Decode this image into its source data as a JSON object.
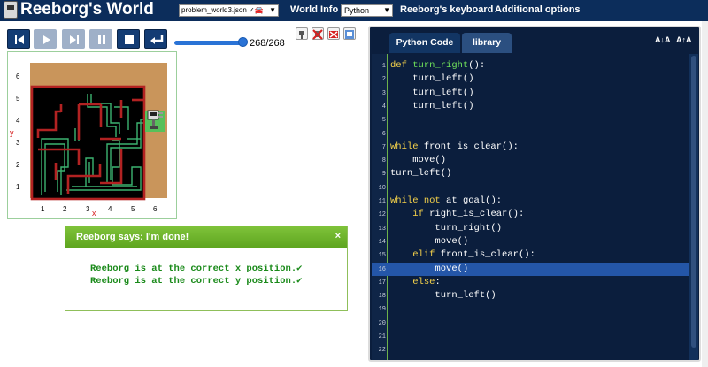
{
  "header": {
    "app_title": "Reeborg's World",
    "world_file": "problem_world3.json ✓🚘",
    "menu_world_info": "World Info",
    "language": "Python",
    "menu_keyboard": "Reeborg's keyboard",
    "menu_options": "Additional options"
  },
  "controls": {
    "step_current": 268,
    "step_total": 268,
    "step_display": "268/268",
    "buttons": [
      "rewind-icon",
      "play-icon",
      "step-icon",
      "pause-icon",
      "stop-icon",
      "return-icon"
    ]
  },
  "world": {
    "y_labels": [
      "6",
      "5",
      "4",
      "3",
      "2",
      "1"
    ],
    "x_labels": [
      "1",
      "2",
      "3",
      "4",
      "5",
      "6"
    ],
    "x_axis_letter": "x",
    "y_axis_letter": "y",
    "colors": {
      "sand": "#c9955b",
      "floor": "#000000",
      "wall": "#b22222",
      "path": "#3cb371",
      "goal": "#57c05a"
    }
  },
  "dialog": {
    "title": "Reeborg says: I'm done!",
    "close": "×",
    "line1": "Reeborg is at the correct x position.✔",
    "line2": "Reeborg is at the correct y position.✔"
  },
  "editor": {
    "tab_code": "Python Code",
    "tab_library": "library",
    "font_decrease": "A↓A",
    "font_increase": "A↑A",
    "highlighted_line": 16,
    "lines": [
      {
        "n": "1",
        "indent": "",
        "parts": [
          [
            "kw",
            "def"
          ],
          [
            "t",
            " "
          ],
          [
            "fn",
            "turn_right"
          ],
          [
            "t",
            "():"
          ]
        ]
      },
      {
        "n": "2",
        "indent": "    ",
        "parts": [
          [
            "t",
            "turn_left()"
          ]
        ]
      },
      {
        "n": "3",
        "indent": "    ",
        "parts": [
          [
            "t",
            "turn_left()"
          ]
        ]
      },
      {
        "n": "4",
        "indent": "    ",
        "parts": [
          [
            "t",
            "turn_left()"
          ]
        ]
      },
      {
        "n": "5",
        "indent": "",
        "parts": []
      },
      {
        "n": "6",
        "indent": "",
        "parts": []
      },
      {
        "n": "7",
        "indent": "",
        "parts": [
          [
            "kw",
            "while"
          ],
          [
            "t",
            " front_is_clear():"
          ]
        ]
      },
      {
        "n": "8",
        "indent": "    ",
        "parts": [
          [
            "t",
            "move()"
          ]
        ]
      },
      {
        "n": "9",
        "indent": "",
        "parts": [
          [
            "t",
            "turn_left()"
          ]
        ]
      },
      {
        "n": "10",
        "indent": "",
        "parts": []
      },
      {
        "n": "11",
        "indent": "",
        "parts": [
          [
            "kw",
            "while"
          ],
          [
            "t",
            " "
          ],
          [
            "kw",
            "not"
          ],
          [
            "t",
            " at_goal():"
          ]
        ]
      },
      {
        "n": "12",
        "indent": "    ",
        "parts": [
          [
            "kw",
            "if"
          ],
          [
            "t",
            " right_is_clear():"
          ]
        ]
      },
      {
        "n": "13",
        "indent": "        ",
        "parts": [
          [
            "t",
            "turn_right()"
          ]
        ]
      },
      {
        "n": "14",
        "indent": "        ",
        "parts": [
          [
            "t",
            "move()"
          ]
        ]
      },
      {
        "n": "15",
        "indent": "    ",
        "parts": [
          [
            "kw",
            "elif"
          ],
          [
            "t",
            " front_is_clear():"
          ]
        ]
      },
      {
        "n": "16",
        "indent": "        ",
        "parts": [
          [
            "t",
            "move()"
          ]
        ]
      },
      {
        "n": "17",
        "indent": "    ",
        "parts": [
          [
            "kw",
            "else"
          ],
          [
            "t",
            ":"
          ]
        ]
      },
      {
        "n": "18",
        "indent": "        ",
        "parts": [
          [
            "t",
            "turn_left()"
          ]
        ]
      },
      {
        "n": "19",
        "indent": "",
        "parts": []
      },
      {
        "n": "20",
        "indent": "",
        "parts": []
      },
      {
        "n": "21",
        "indent": "",
        "parts": []
      },
      {
        "n": "22",
        "indent": "",
        "parts": []
      }
    ]
  }
}
